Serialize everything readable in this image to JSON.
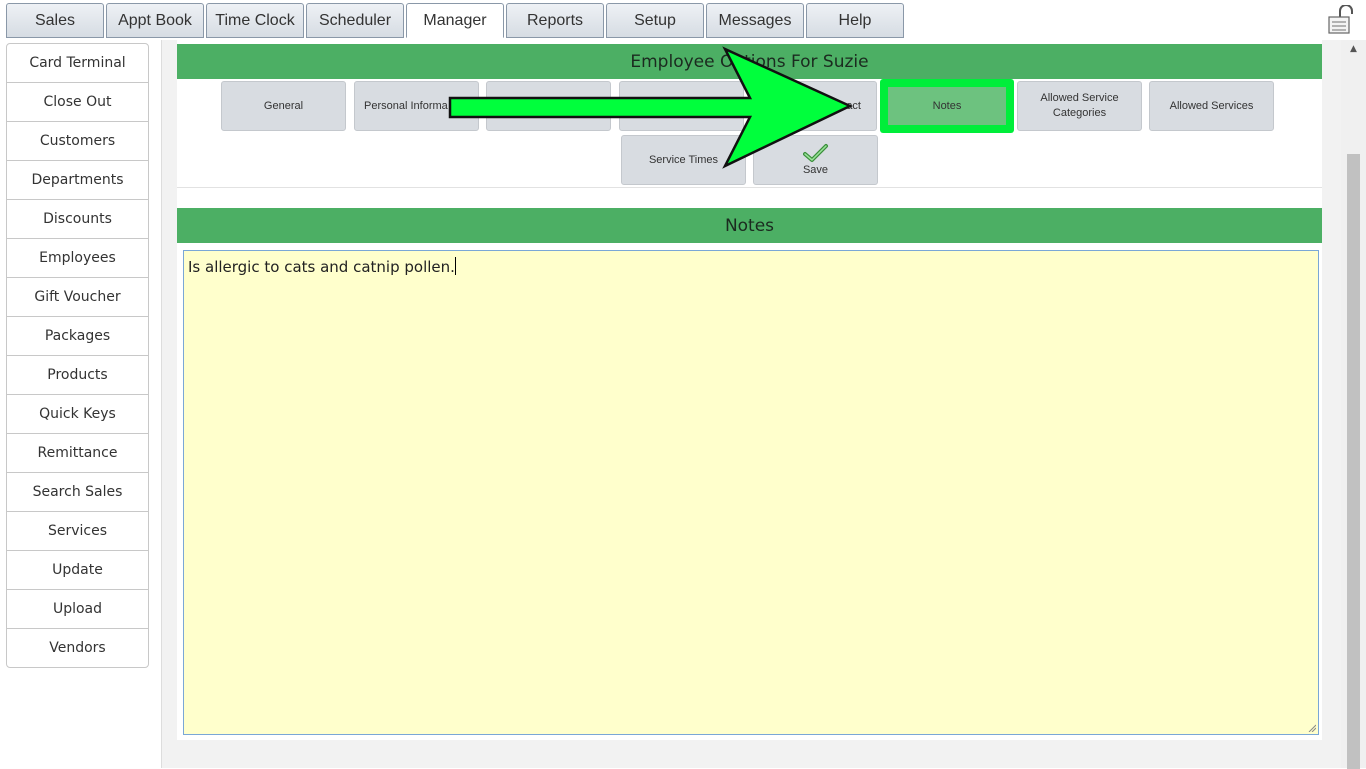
{
  "top_tabs": [
    {
      "label": "Sales"
    },
    {
      "label": "Appt Book"
    },
    {
      "label": "Time Clock"
    },
    {
      "label": "Scheduler"
    },
    {
      "label": "Manager"
    },
    {
      "label": "Reports"
    },
    {
      "label": "Setup"
    },
    {
      "label": "Messages"
    },
    {
      "label": "Help"
    }
  ],
  "active_tab": "Manager",
  "sidebar": {
    "items": [
      {
        "label": "Card Terminal"
      },
      {
        "label": "Close Out"
      },
      {
        "label": "Customers"
      },
      {
        "label": "Departments"
      },
      {
        "label": "Discounts"
      },
      {
        "label": "Employees"
      },
      {
        "label": "Gift Voucher"
      },
      {
        "label": "Packages"
      },
      {
        "label": "Products"
      },
      {
        "label": "Quick Keys"
      },
      {
        "label": "Remittance"
      },
      {
        "label": "Search Sales"
      },
      {
        "label": "Services"
      },
      {
        "label": "Update"
      },
      {
        "label": "Upload"
      },
      {
        "label": "Vendors"
      }
    ]
  },
  "options": {
    "title": "Employee Options For Suzie",
    "buttons": [
      {
        "label": "General"
      },
      {
        "label": "Personal Informa"
      },
      {
        "label": ""
      },
      {
        "label": ""
      },
      {
        "label": "act"
      },
      {
        "label": "Notes"
      },
      {
        "label": "Allowed Service Categories"
      },
      {
        "label": "Allowed Services"
      },
      {
        "label": "Service Times"
      }
    ],
    "save_label": "Save",
    "selected": "Notes"
  },
  "notes": {
    "title": "Notes",
    "text": "Is allergic to cats and catnip pollen."
  },
  "colors": {
    "header_green": "#4caf64",
    "highlight_green": "#00ee3a",
    "notes_bg": "#ffffcc"
  }
}
